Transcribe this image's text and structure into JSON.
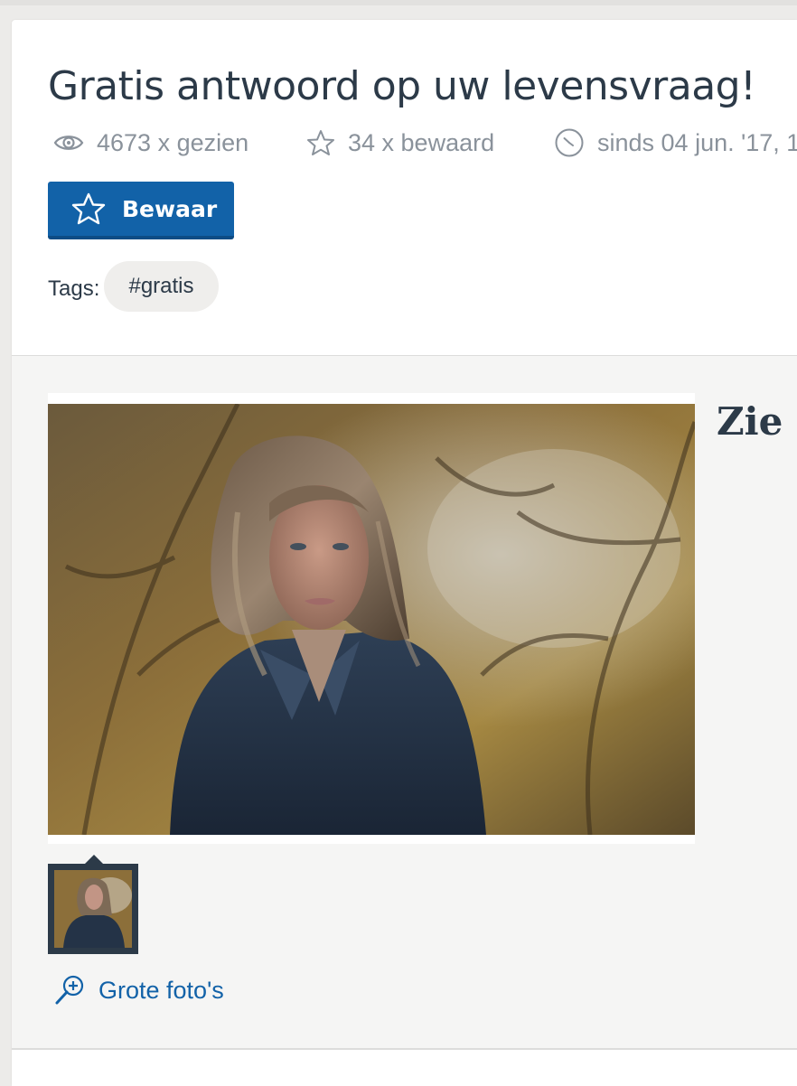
{
  "header": {
    "title": "Gratis antwoord op uw levensvraag!",
    "views": "4673 x gezien",
    "saves": "34 x bewaard",
    "since": "sinds 04 jun. '17, 1"
  },
  "actions": {
    "save_label": "Bewaar"
  },
  "tags": {
    "label": "Tags:",
    "items": [
      "#gratis"
    ]
  },
  "gallery": {
    "side_heading": "Zie o",
    "large_photos_link": "Grote foto's"
  },
  "icons": [
    "eye-icon",
    "star-outline-icon",
    "clock-icon",
    "star-icon",
    "zoom-in-icon"
  ],
  "colors": {
    "primary": "#1262a8",
    "text": "#2c3a48",
    "muted": "#8a929b",
    "chip_bg": "#efeeec"
  }
}
